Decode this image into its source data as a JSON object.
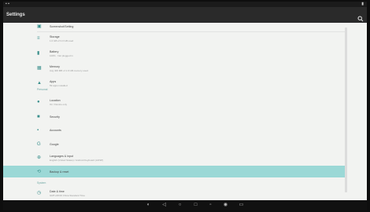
{
  "status": {
    "left": "▪ ▪",
    "right": "▮"
  },
  "toolbar": {
    "title": "Settings"
  },
  "items": [
    {
      "label": "Screenshot/Setting",
      "sub": ""
    },
    {
      "label": "Storage",
      "sub": "1.0 GB of 3.0 GB used"
    },
    {
      "label": "Battery",
      "sub": "100% · Not plugged in"
    },
    {
      "label": "Memory",
      "sub": "Avg 400 MB of 1.9 GB memory used"
    },
    {
      "label": "Apps",
      "sub": "59 apps installed"
    }
  ],
  "section_personal": "Personal",
  "personal": [
    {
      "label": "Location",
      "sub": "On / Device only"
    },
    {
      "label": "Security",
      "sub": ""
    },
    {
      "label": "Accounts",
      "sub": ""
    },
    {
      "label": "Google",
      "sub": ""
    },
    {
      "label": "Languages & input",
      "sub": "English (United States) / Android Keyboard (AOSP)"
    },
    {
      "label": "Backup & reset",
      "sub": ""
    }
  ],
  "section_system": "System",
  "system": [
    {
      "label": "Date & time",
      "sub": "GMT+08:00 China Standard Time"
    }
  ],
  "nav": {
    "icons": [
      "screen-power-icon",
      "back-icon",
      "home-icon",
      "recents-icon",
      "screenshot-icon",
      "camera-icon",
      "keyboard-icon"
    ]
  }
}
